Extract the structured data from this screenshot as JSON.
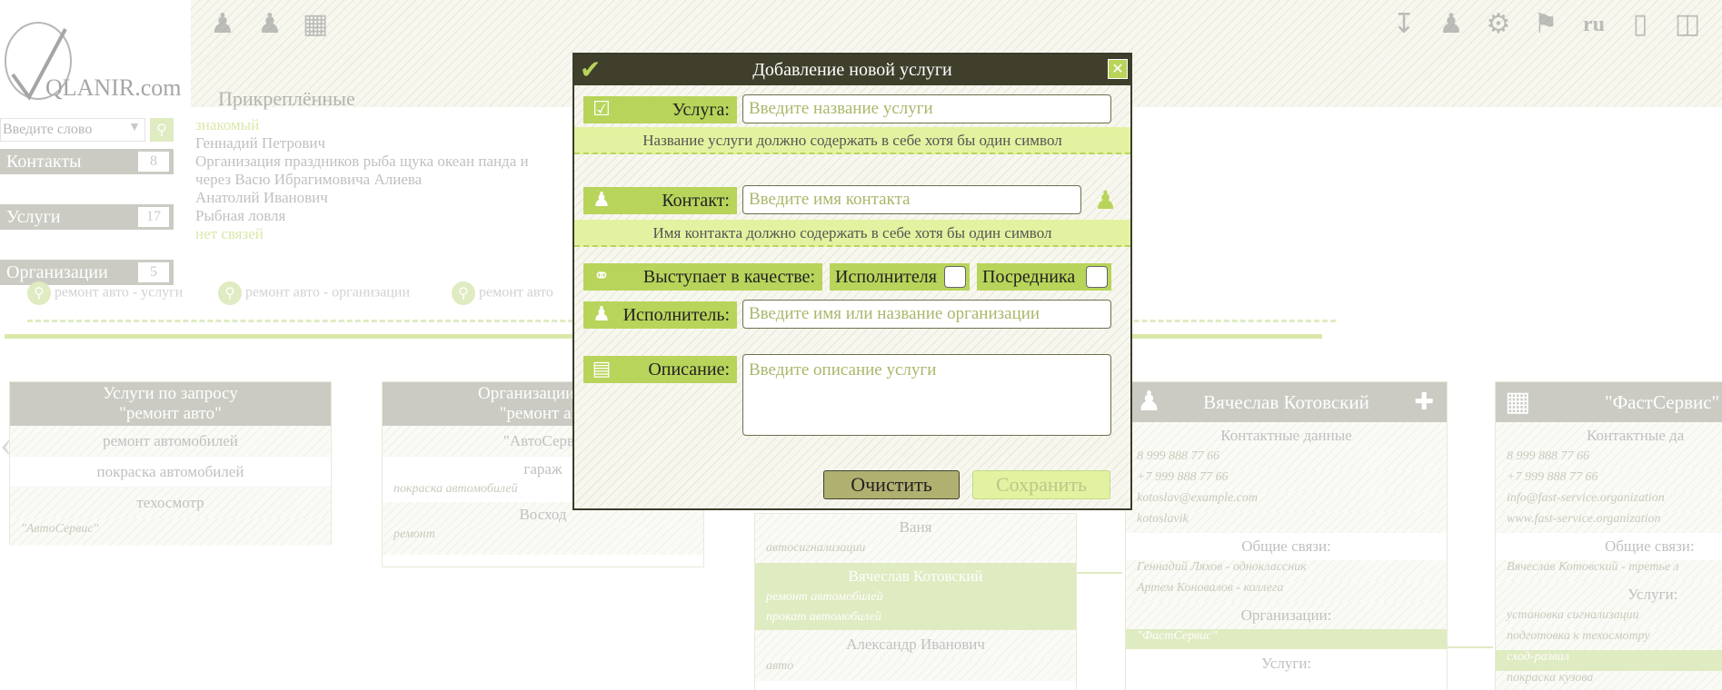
{
  "logo": {
    "text": "QLANIR.com"
  },
  "header": {
    "pinned_title": "Прикреплённые",
    "lang": "ru"
  },
  "search": {
    "placeholder": "Введите слово"
  },
  "sidebar": {
    "items": [
      {
        "label": "Контакты",
        "count": "8"
      },
      {
        "label": "Услуги",
        "count": "17"
      },
      {
        "label": "Организации",
        "count": "5"
      }
    ]
  },
  "pinned": {
    "items": [
      "знакомый",
      "Геннадий Петрович",
      "Организация праздников рыба щука океан панда и",
      "через Васю Ибрагимовича Алиева",
      "Анатолий Иванович",
      "Рыбная ловля",
      "нет связей"
    ]
  },
  "chain": {
    "items": [
      "ремонт авто - услуги",
      "ремонт авто - организации",
      "ремонт авто"
    ]
  },
  "col1": {
    "title_line1": "Услуги по запросу",
    "title_line2": "\"ремонт авто\"",
    "rows": [
      "ремонт автомобилей",
      "покраска автомобилей",
      "техосмотр"
    ],
    "sub": "\"АвтоСервис\""
  },
  "col2": {
    "title_line1": "Организации по з",
    "title_line2": "\"ремонт авт",
    "rows": [
      "\"АвтоСерви",
      "гараж",
      "Восход"
    ],
    "sub1": "покраска автомобилей",
    "sub2": "ремонт"
  },
  "col3": {
    "rows": [
      "Ваня",
      "Вячеслав Котовский",
      "Александр Иванович"
    ],
    "subs": [
      "автосигнализации",
      "ремонт автомобилей",
      "прокат автомобилей",
      "авто"
    ]
  },
  "col4": {
    "title": "Вячеслав Котовский",
    "contact_header": "Контактные данные",
    "phones": [
      "8 999 888 77 66",
      "+7 999 888 77 66"
    ],
    "email": "kotoslav@example.com",
    "skype": "kotoslavik",
    "links_header": "Общие связи:",
    "links": [
      "Геннадий Ляхов - одноклассник",
      "Артем Коновалов - коллега"
    ],
    "org_header": "Организации:",
    "org": "\"ФастСервис\"",
    "services_header": "Услуги:"
  },
  "col5": {
    "title": "\"ФастСервис\"",
    "contact_header": "Контактные да",
    "phones": [
      "8 999 888 77 66",
      "+7 999 888 77 66"
    ],
    "email": "info@fast-service.organization",
    "site": "www.fast-service.organization",
    "links_header": "Общие связи:",
    "link": "Вячеслав Котовский - третье л",
    "services_header": "Услуги:",
    "services": [
      "установка сигнализации",
      "подготовка к техосмотру",
      "сход-развал",
      "покраска кузова"
    ]
  },
  "modal": {
    "title": "Добавление новой услуги",
    "service_label": "Услуга:",
    "service_placeholder": "Введите название услуги",
    "service_hint": "Название услуги должно содержать в себе хотя бы один символ",
    "contact_label": "Контакт:",
    "contact_placeholder": "Введите имя контакта",
    "contact_hint": "Имя контакта должно содержать в себе хотя бы один символ",
    "role_label": "Выступает в качестве:",
    "role_performer": "Исполнителя",
    "role_mediator": "Посредника",
    "executor_label": "Исполнитель:",
    "executor_placeholder": "Введите имя или название организации",
    "description_label": "Описание:",
    "description_placeholder": "Введите описание услуги",
    "clear_label": "Очистить",
    "save_label": "Сохранить"
  },
  "colors": {
    "accent": "#b8d45a",
    "dark": "#3f3f2c",
    "hint": "#e3f2a0",
    "grey": "#9d9d90"
  }
}
